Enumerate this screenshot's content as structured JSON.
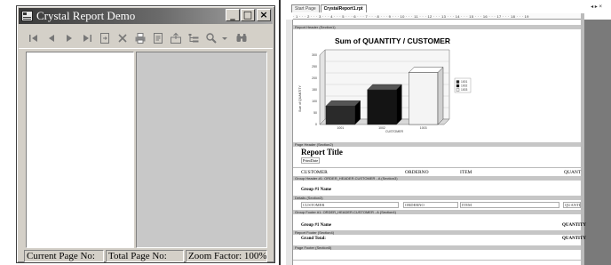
{
  "window": {
    "title": "Crystal Report Demo",
    "buttons": {
      "minimize": "_",
      "maximize": "□",
      "close": "×"
    }
  },
  "toolbar": {
    "icons": [
      "first-page-icon",
      "prev-page-icon",
      "next-page-icon",
      "last-page-icon",
      "goto-page-icon",
      "close-view-icon",
      "print-icon",
      "export-icon",
      "refresh-icon",
      "group-tree-icon",
      "zoom-icon",
      "search-icon"
    ]
  },
  "statusbar": {
    "current_page": "Current Page No:",
    "total_page": "Total Page No:",
    "zoom": "Zoom Factor: 100%"
  },
  "designer": {
    "tabs": [
      "Start Page",
      "CrystalReport1.rpt"
    ],
    "ruler": "· 1 · · · 2 · · · 3 · · · 4 · · · 5 · · · 6 · · · 7 · · · 8 · · · 9 · · · 10 · · · 11 · · · 12 · · · 13 · · · 14 · · · 15 · · · 16 · · · 17 · · · 18 · · · 19",
    "sections": {
      "report_header": "Report Header (Section1)",
      "page_header": "Page Header (Section2)",
      "group_header": "Group Header #1: ORDER_HEADER.CUSTOMER - A (Section3)",
      "details": "Details (Section3)",
      "group_footer": "Group Footer #1: ORDER_HEADER.CUSTOMER - A (Section4)",
      "report_footer": "Report Footer (Section4)",
      "page_footer": "Page Footer (Section5)"
    },
    "report_title": "Report Title",
    "print_date": "PrintDate",
    "columns": [
      "CUSTOMER",
      "ORDERNO",
      "ITEM",
      "QUANT"
    ],
    "group_name": "Group #1 Name",
    "detail_fields": [
      "CUSTOMER",
      "ORDERNO",
      "ITEM",
      "QUANTITY"
    ],
    "group_name_2": "Group #1 Name",
    "quantity_sum": "QUANTITY",
    "grand_total": "Grand Total:",
    "grand_total_value": "QUANTITY"
  },
  "chart_data": {
    "type": "bar",
    "title": "Sum of QUANTITY / CUSTOMER",
    "categories": [
      "1001",
      "1002",
      "1003"
    ],
    "values": [
      80,
      150,
      225
    ],
    "xlabel": "CUSTOMER",
    "ylabel": "Sum of QUANTITY",
    "ylim": [
      0,
      300
    ],
    "yticks": [
      "300",
      "250",
      "200",
      "150",
      "100",
      "50",
      "0"
    ],
    "legend": [
      "1001",
      "1002",
      "1003"
    ],
    "colors": [
      "#2a2a2a",
      "#141414",
      "#f4f4f4"
    ]
  }
}
